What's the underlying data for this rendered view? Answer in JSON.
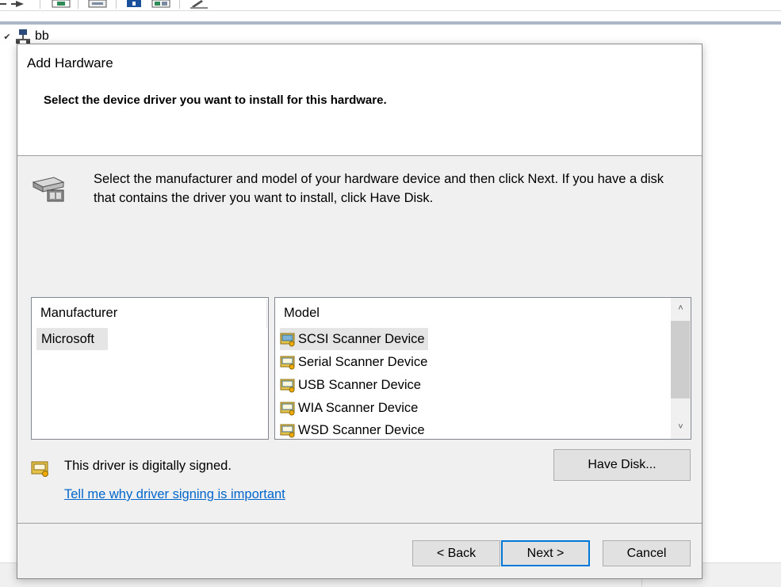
{
  "background": {
    "tree_root_label": "bb"
  },
  "dialog": {
    "title": "Add Hardware",
    "subtitle": "Select the device driver you want to install for this hardware.",
    "intro_text": "Select the manufacturer and model of your hardware device and then click Next. If you have a disk that contains the driver you want to install, click Have Disk.",
    "manufacturer": {
      "header": "Manufacturer",
      "items": [
        "Microsoft"
      ],
      "selected": "Microsoft"
    },
    "model": {
      "header": "Model",
      "items": [
        "SCSI Scanner Device",
        "Serial Scanner Device",
        "USB Scanner Device",
        "WIA Scanner Device",
        "WSD Scanner Device"
      ],
      "selected": "SCSI Scanner Device"
    },
    "signed_text": "This driver is digitally signed.",
    "signing_link": "Tell me why driver signing is important",
    "have_disk_label": "Have Disk...",
    "back_label": "< Back",
    "next_label": "Next >",
    "cancel_label": "Cancel"
  },
  "icons": {
    "hardware_wizard": "hardware-wizard-icon",
    "driver_signed": "signed-driver-icon",
    "scanner": "scanner-device-icon",
    "network_computer": "computer-network-icon",
    "scroll_up": "chevron-up-icon",
    "scroll_down": "chevron-down-icon"
  },
  "colors": {
    "link": "#0066cc",
    "default_button_border": "#0078d7",
    "selection": "#e5e5e5",
    "dialog_bg": "#f0f0f0"
  }
}
